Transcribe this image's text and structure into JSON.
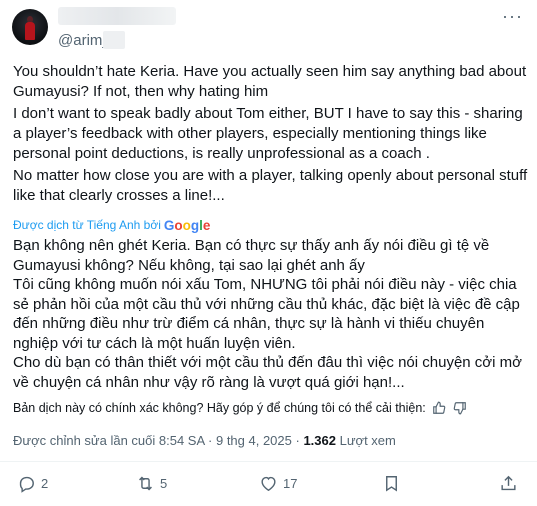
{
  "author": {
    "handle": "@arim_"
  },
  "menu_icon": "more-dots-icon",
  "tweet": {
    "lines": [
      "You shouldn’t hate Keria. Have you actually seen him say anything bad about Gumayusi? If not, then why hating him",
      "I don’t want to speak badly about Tom either, BUT I have to say this - sharing a player’s feedback with other players, especially mentioning things like personal point deductions, is really unprofessional as a coach .",
      "No matter how close you are with a player, talking openly about personal stuff like that clearly crosses a line!..."
    ]
  },
  "translation": {
    "label": "Được dịch từ Tiếng Anh bởi",
    "provider": "Google",
    "lines": [
      "Bạn không nên ghét Keria. Bạn có thực sự thấy anh ấy nói điều gì tệ về Gumayusi không? Nếu không, tại sao lại ghét anh ấy",
      "Tôi cũng không muốn nói xấu Tom, NHƯNG tôi phải nói điều này - việc chia sẻ phản hồi của một cầu thủ với những cầu thủ khác, đặc biệt là việc đề cập đến những điều như trừ điểm cá nhân, thực sự là hành vi thiếu chuyên nghiệp với tư cách là một huấn luyện viên.",
      "Cho dù bạn có thân thiết với một cầu thủ đến đâu thì việc nói chuyện cởi mở về chuyện cá nhân như vậy rõ ràng là vượt quá giới hạn!..."
    ],
    "feedback_prompt": "Bản dịch này có chính xác không? Hãy góp ý để chúng tôi có thể cải thiện:"
  },
  "meta": {
    "edited": "Được chỉnh sửa lần cuối 8:54 SA · 9 thg 4, 2025 ·",
    "views_count": "1.362",
    "views_label": "Lượt xem"
  },
  "actions": {
    "replies": "2",
    "reposts": "5",
    "likes": "17"
  }
}
